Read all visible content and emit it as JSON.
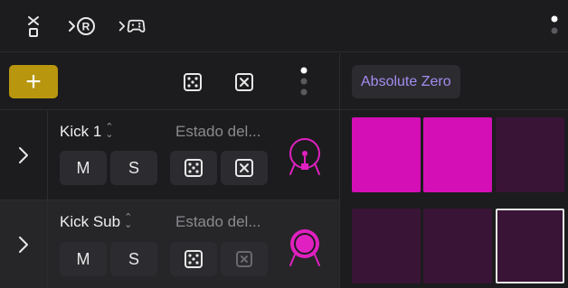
{
  "toolbar": {
    "icons": [
      "swap-icon",
      "record-routing-icon",
      "gamepad-routing-icon",
      "more-icon"
    ]
  },
  "controls": {
    "add_label": "+",
    "icons": [
      "dice-icon",
      "close-box-icon",
      "more-vertical-icon"
    ]
  },
  "pattern": {
    "label": "Absolute Zero"
  },
  "tracks": [
    {
      "name": "Kick 1",
      "state": "Estado del...",
      "mute_label": "M",
      "solo_label": "S",
      "clear_enabled": true,
      "drum_active": false,
      "cells": [
        "on",
        "on",
        "off"
      ]
    },
    {
      "name": "Kick Sub",
      "state": "Estado del...",
      "mute_label": "M",
      "solo_label": "S",
      "clear_enabled": false,
      "drum_active": true,
      "cells": [
        "off",
        "off",
        "off-selected"
      ]
    }
  ],
  "colors": {
    "accent_yellow": "#b8960e",
    "pattern_purple": "#a58cf0",
    "cell_on": "#d40fb5",
    "cell_off": "#3a1436"
  }
}
